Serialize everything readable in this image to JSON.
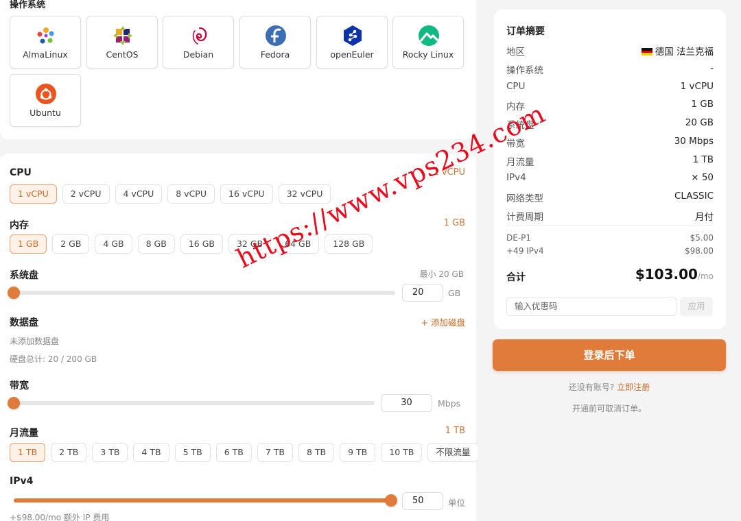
{
  "os": {
    "title": "操作系统",
    "items": [
      {
        "label": "AlmaLinux",
        "icon": "almalinux-icon"
      },
      {
        "label": "CentOS",
        "icon": "centos-icon"
      },
      {
        "label": "Debian",
        "icon": "debian-icon"
      },
      {
        "label": "Fedora",
        "icon": "fedora-icon"
      },
      {
        "label": "openEuler",
        "icon": "openeuler-icon"
      },
      {
        "label": "Rocky Linux",
        "icon": "rocky-linux-icon"
      },
      {
        "label": "Ubuntu",
        "icon": "ubuntu-icon"
      }
    ]
  },
  "cpu": {
    "title": "CPU",
    "selected_value": "1 vCPU",
    "options": [
      "1 vCPU",
      "2 vCPU",
      "4 vCPU",
      "8 vCPU",
      "16 vCPU",
      "32 vCPU"
    ]
  },
  "memory": {
    "title": "内存",
    "selected_value": "1 GB",
    "options": [
      "1 GB",
      "2 GB",
      "4 GB",
      "8 GB",
      "16 GB",
      "32 GB",
      "64 GB",
      "128 GB"
    ]
  },
  "system_disk": {
    "title": "系统盘",
    "min_hint": "最小 20 GB",
    "value": "20",
    "unit": "GB",
    "level": 0
  },
  "data_disk": {
    "title": "数据盘",
    "add_label": "+ 添加磁盘",
    "empty_text": "未添加数据盘",
    "total_text": "硬盘总计: 20 / 200 GB"
  },
  "bandwidth": {
    "title": "带宽",
    "value": "30",
    "unit": "Mbps",
    "level": 0
  },
  "traffic": {
    "title": "月流量",
    "selected_value": "1 TB",
    "options": [
      "1 TB",
      "2 TB",
      "3 TB",
      "4 TB",
      "5 TB",
      "6 TB",
      "7 TB",
      "8 TB",
      "9 TB",
      "10 TB",
      "不限流量"
    ]
  },
  "ipv4": {
    "title": "IPv4",
    "value": "50",
    "unit": "单位",
    "level": 1.0,
    "fee_note": "+$98.00/mo 额外 IP 费用"
  },
  "summary": {
    "title": "订单摘要",
    "region_label": "地区",
    "region_value": "德国 法兰克福",
    "rows": [
      {
        "k": "操作系统",
        "v": "-"
      },
      {
        "k": "CPU",
        "v": "1 vCPU"
      },
      {
        "k": "内存",
        "v": "1 GB"
      },
      {
        "k": "系统盘",
        "v": "20 GB"
      },
      {
        "k": "带宽",
        "v": "30 Mbps"
      },
      {
        "k": "月流量",
        "v": "1 TB"
      },
      {
        "k": "IPv4",
        "v": "× 50"
      },
      {
        "k": "网络类型",
        "v": "CLASSIC"
      },
      {
        "k": "计费周期",
        "v": "月付"
      }
    ],
    "lines": [
      {
        "k": "DE-P1",
        "v": "$5.00"
      },
      {
        "k": "+49 IPv4",
        "v": "$98.00"
      }
    ],
    "total_label": "合计",
    "total_amount": "$103.00",
    "total_period": "/mo",
    "coupon_placeholder": "输入优惠码",
    "apply_label": "应用"
  },
  "login_button": "登录后下单",
  "register_prompt": "还没有账号?",
  "register_link": "立即注册",
  "cancel_note": "开通前可取消订单。",
  "watermark": "https://www.vps234.com",
  "colors": {
    "accent": "#e07b39",
    "watermark": "#e60012"
  }
}
